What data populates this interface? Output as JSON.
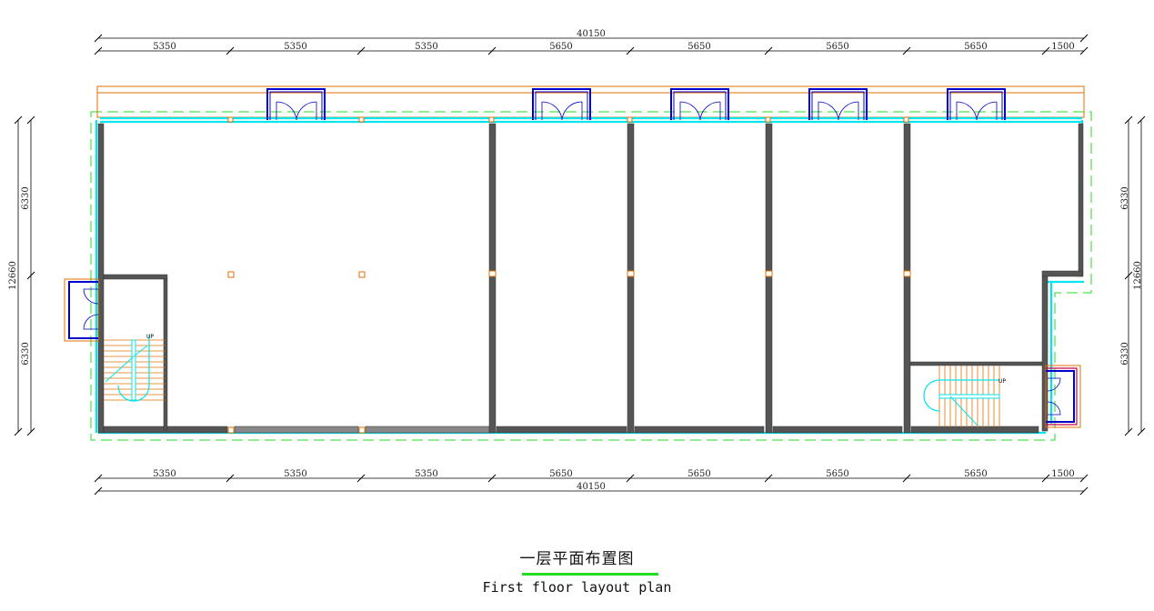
{
  "title": {
    "cn": "一层平面布置图",
    "en": "First floor layout plan"
  },
  "dimensions": {
    "top_total": "40150",
    "top_bays": [
      "5350",
      "5350",
      "5350",
      "5650",
      "5650",
      "5650",
      "5650",
      "1500"
    ],
    "bottom_bays": [
      "5350",
      "5350",
      "5350",
      "5650",
      "5650",
      "5650",
      "5650",
      "1500"
    ],
    "bottom_total": "40150",
    "left_parts": [
      "6330",
      "6330"
    ],
    "left_total": "12660",
    "right_parts": [
      "6330",
      "6330"
    ],
    "right_total": "12660"
  },
  "labels": {
    "stair_left_up": "UP",
    "stair_right_up": "UP"
  },
  "colors": {
    "wall": "#555555",
    "window": "#00e5ee",
    "door": "#0000cc",
    "outline": "#e07000",
    "boundary": "#22dd22",
    "dim_line": "#000000"
  }
}
